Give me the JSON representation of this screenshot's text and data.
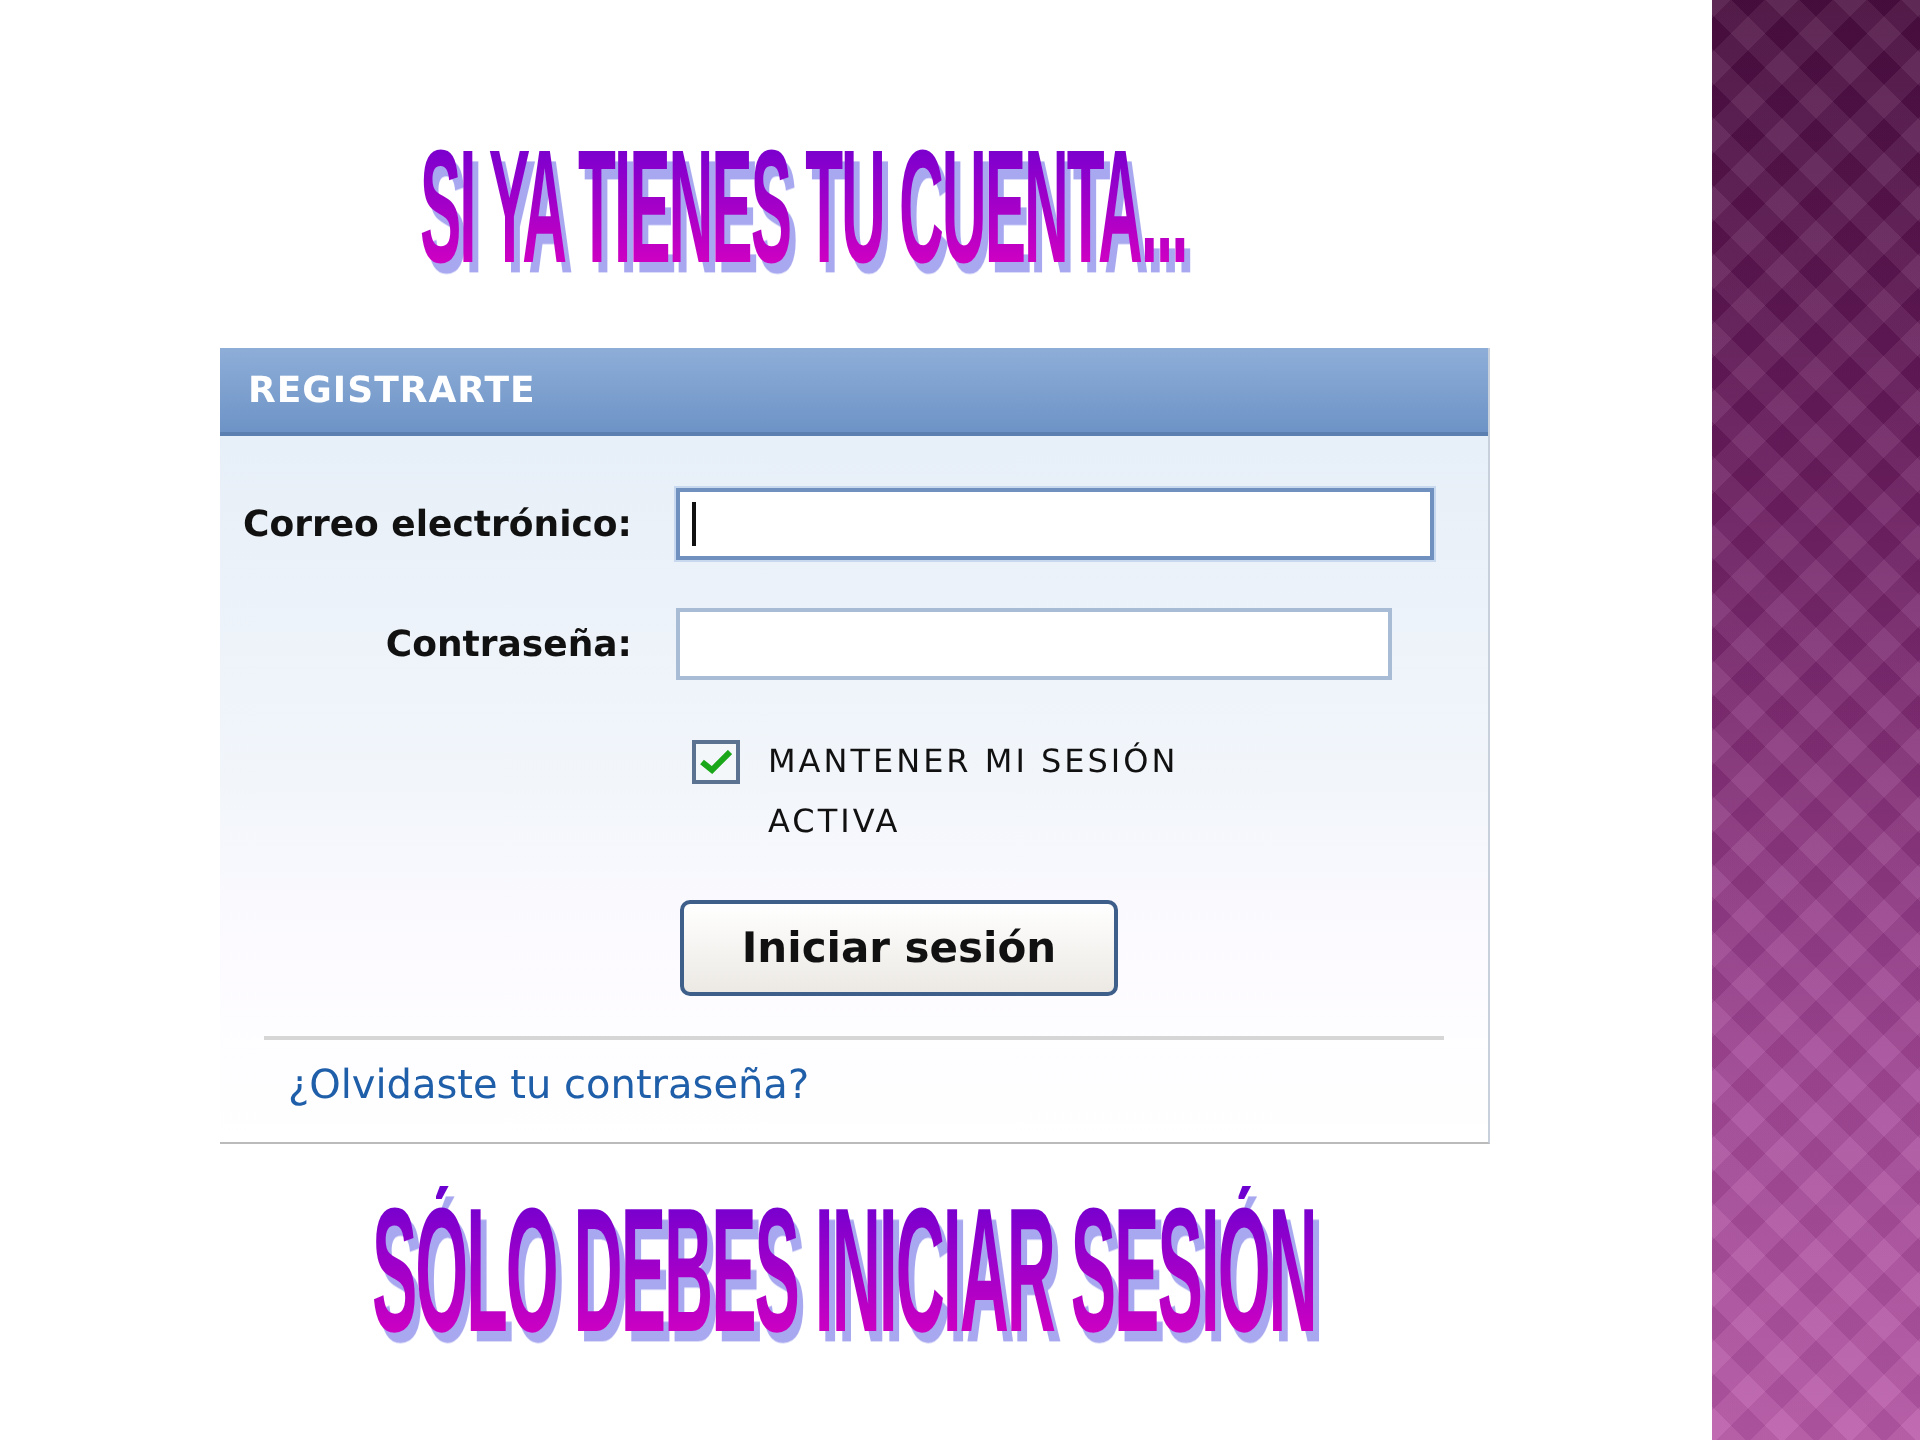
{
  "heading": "SI YA TIENES TU CUENTA...",
  "login": {
    "title": "REGISTRARTE",
    "fields": [
      {
        "label": "Correo electrónico:",
        "focused": true
      },
      {
        "label": "Contraseña:",
        "focused": false
      }
    ],
    "remember": {
      "label": "MANTENER MI SESIÓN ACTIVA",
      "checked": true
    },
    "button": "Iniciar sesión",
    "link": "¿Olvidaste tu contraseña?"
  },
  "footer": "SÓLO DEBES INICIAR SESIÓN"
}
